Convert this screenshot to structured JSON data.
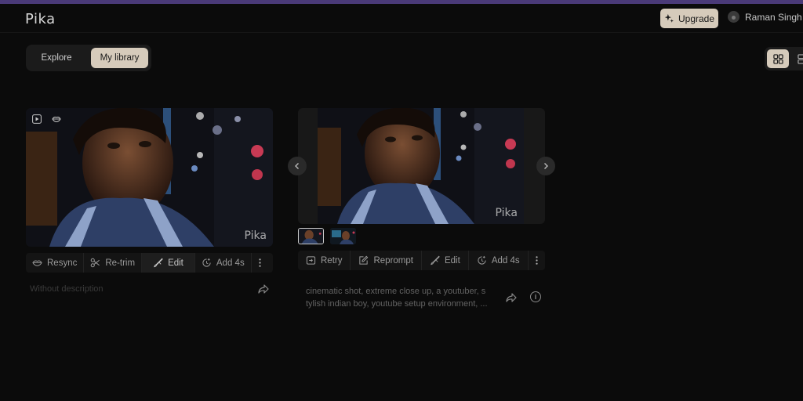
{
  "app": {
    "logo": "Pika"
  },
  "header": {
    "upgrade_label": "Upgrade",
    "user_name": "Raman Singh"
  },
  "tabs": {
    "explore": "Explore",
    "library": "My library",
    "active": "My library"
  },
  "colors": {
    "accent": "#d6cbbb",
    "topstripe": "#4a3a78",
    "background": "#0b0b0b"
  },
  "cards": [
    {
      "watermark": "Pika",
      "actions": [
        "Resync",
        "Re-trim",
        "Edit",
        "Add 4s"
      ],
      "active_action": "Edit",
      "description_placeholder": "Without description"
    },
    {
      "watermark": "Pika",
      "actions": [
        "Retry",
        "Reprompt",
        "Edit",
        "Add 4s"
      ],
      "description": "cinematic shot, extreme close up, a youtuber, stylish indian boy, youtube setup environment, ...",
      "description_lines": [
        "cinematic shot, extreme close up, a youtuber, s",
        "tylish indian boy, youtube setup environment, ..."
      ],
      "variants": 2,
      "selected_variant": 1
    }
  ]
}
